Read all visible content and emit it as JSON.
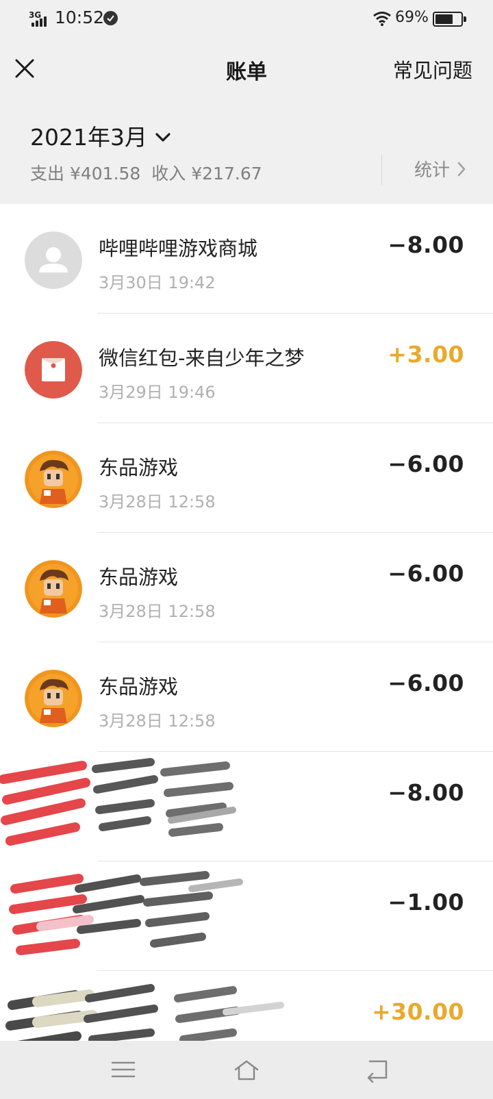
{
  "status_bar": {
    "network": "3G",
    "time": "10:52",
    "battery_percent": "69%",
    "battery_level": 0.69
  },
  "nav": {
    "title": "账单",
    "faq_label": "常见问题"
  },
  "summary": {
    "month": "2021年3月",
    "expense": "支出 ¥401.58",
    "income": "收入 ¥217.67",
    "stats_label": "统计"
  },
  "transactions": [
    {
      "name": "哔哩哔哩游戏商城",
      "time": "3月30日 19:42",
      "amount": "−8.00",
      "type": "expense",
      "avatar": "default-user-avatar"
    },
    {
      "name": "微信红包-来自少年之梦",
      "time": "3月29日 19:46",
      "amount": "+3.00",
      "type": "income",
      "avatar": "red-packet-icon"
    },
    {
      "name": "东品游戏",
      "time": "3月28日 12:58",
      "amount": "−6.00",
      "type": "expense",
      "avatar": "game-character-avatar"
    },
    {
      "name": "东品游戏",
      "time": "3月28日 12:58",
      "amount": "−6.00",
      "type": "expense",
      "avatar": "game-character-avatar"
    },
    {
      "name": "东品游戏",
      "time": "3月28日 12:58",
      "amount": "−6.00",
      "type": "expense",
      "avatar": "game-character-avatar"
    },
    {
      "name": "",
      "time": "",
      "amount": "−8.00",
      "type": "expense",
      "avatar": "redacted"
    },
    {
      "name": "",
      "time": "",
      "amount": "−1.00",
      "type": "expense",
      "avatar": "redacted"
    },
    {
      "name": "",
      "time": "",
      "amount": "+30.00",
      "type": "income",
      "avatar": "redacted"
    }
  ],
  "colors": {
    "income": "#e9a92c",
    "expense": "#222222",
    "header_bg": "#f0f0f0",
    "red_packet": "#df5a4a",
    "game_orange": "#f0961e"
  }
}
